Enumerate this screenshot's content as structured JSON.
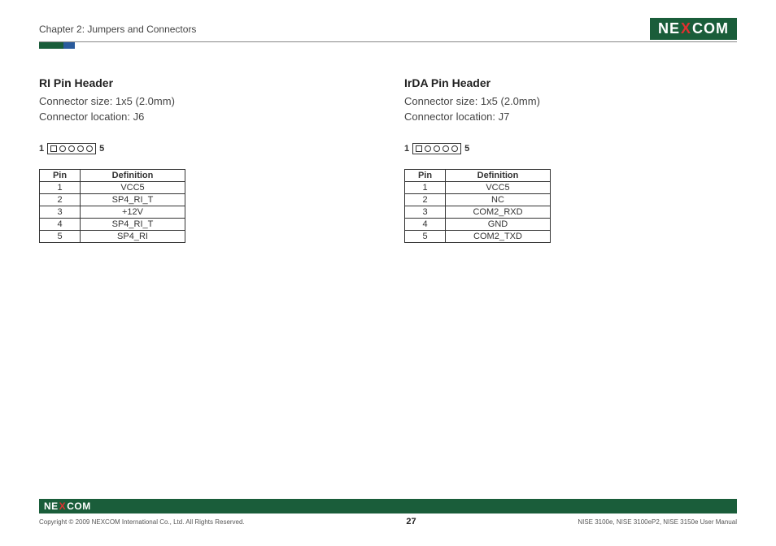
{
  "header": {
    "chapter": "Chapter 2: Jumpers and Connectors",
    "logo_pre": "NE",
    "logo_x": "X",
    "logo_post": "COM"
  },
  "left": {
    "title": "RI Pin Header",
    "size_label": "Connector size:  1x5 (2.0mm)",
    "loc_label": "Connector location: J6",
    "pin_left": "1",
    "pin_right": "5",
    "table": {
      "col_pin": "Pin",
      "col_def": "Definition",
      "rows": [
        {
          "pin": "1",
          "def": "VCC5"
        },
        {
          "pin": "2",
          "def": "SP4_RI_T"
        },
        {
          "pin": "3",
          "def": "+12V"
        },
        {
          "pin": "4",
          "def": "SP4_RI_T"
        },
        {
          "pin": "5",
          "def": "SP4_RI"
        }
      ]
    }
  },
  "right": {
    "title": "IrDA Pin Header",
    "size_label": "Connector size:  1x5 (2.0mm)",
    "loc_label": "Connector location: J7",
    "pin_left": "1",
    "pin_right": "5",
    "table": {
      "col_pin": "Pin",
      "col_def": "Definition",
      "rows": [
        {
          "pin": "1",
          "def": "VCC5"
        },
        {
          "pin": "2",
          "def": "NC"
        },
        {
          "pin": "3",
          "def": "COM2_RXD"
        },
        {
          "pin": "4",
          "def": "GND"
        },
        {
          "pin": "5",
          "def": "COM2_TXD"
        }
      ]
    }
  },
  "footer": {
    "copyright": "Copyright © 2009 NEXCOM International Co., Ltd. All Rights Reserved.",
    "page": "27",
    "manual": "NISE 3100e, NISE 3100eP2, NISE 3150e User Manual"
  }
}
